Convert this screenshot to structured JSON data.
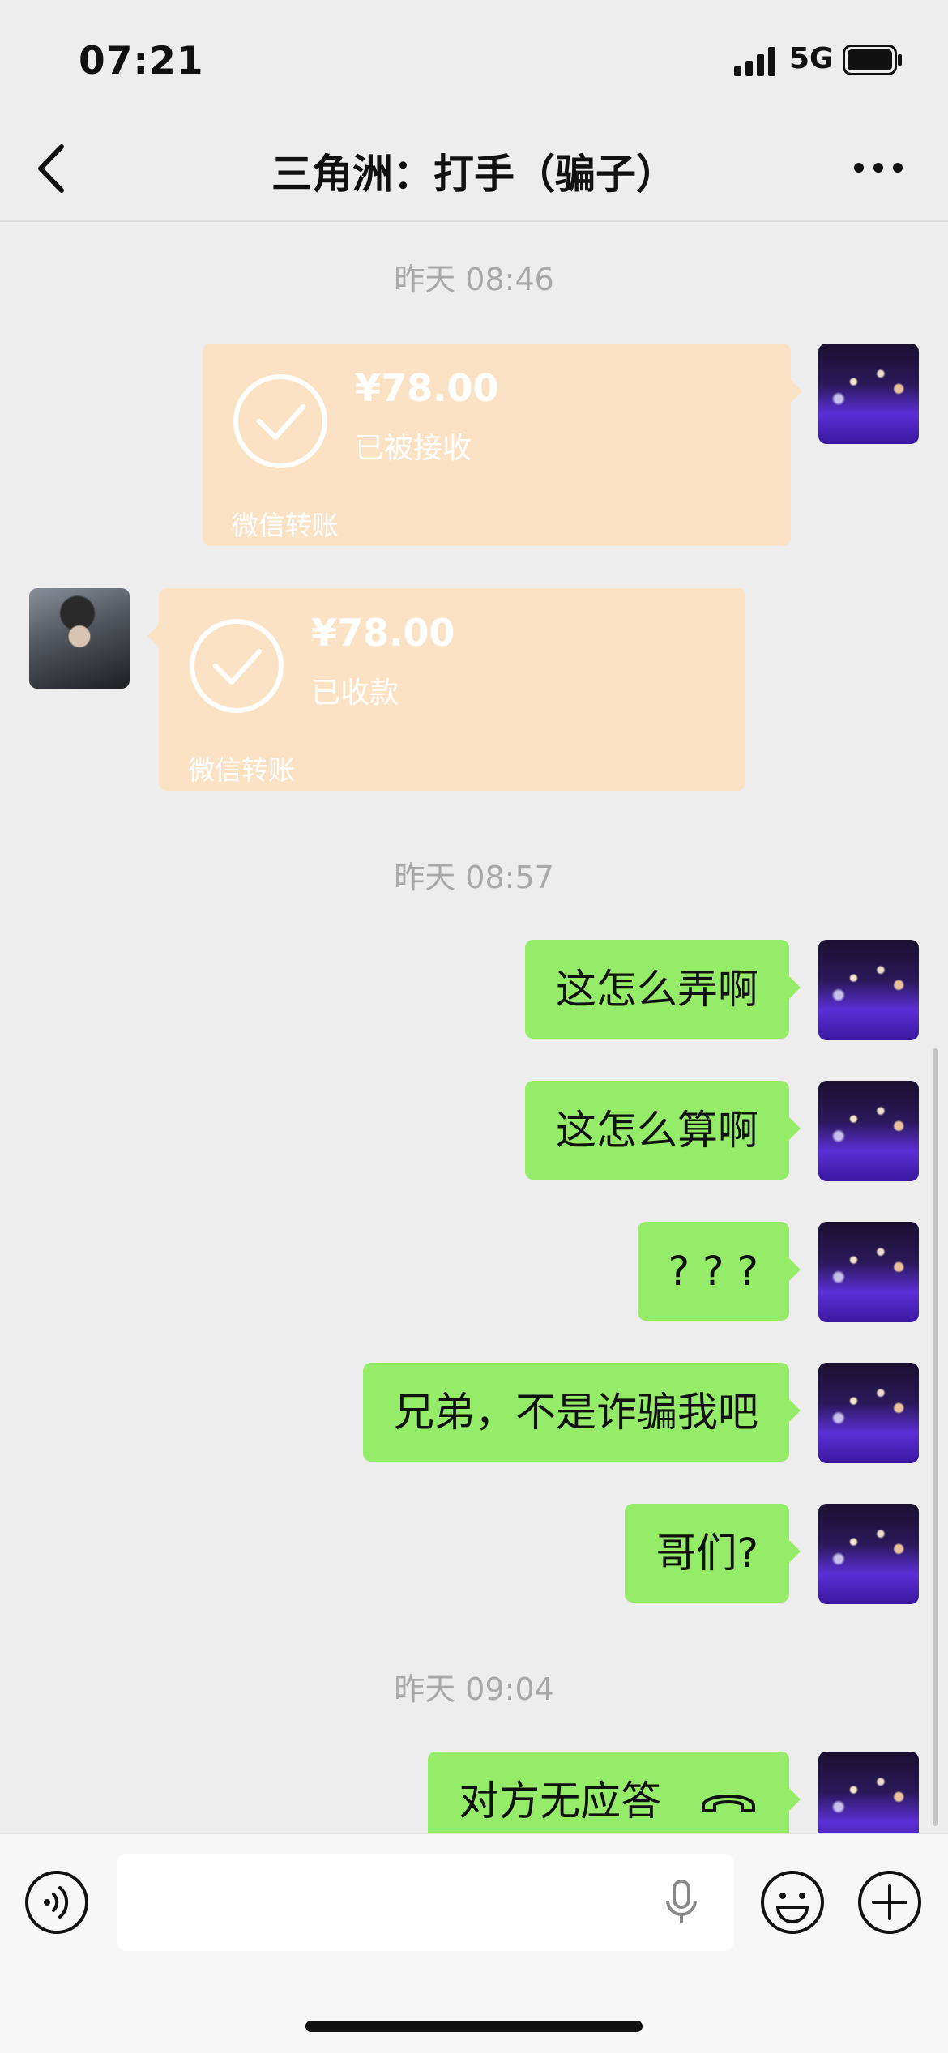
{
  "status_bar": {
    "time": "07:21",
    "network": "5G",
    "signal_icon": "cellular-signal-icon",
    "battery_icon": "battery-icon"
  },
  "header": {
    "title": "三角洲：打手（骗子）",
    "back_icon": "chevron-left-icon",
    "more_icon": "more-dots-icon"
  },
  "chat": {
    "timestamps": [
      "昨天 08:46",
      "昨天 08:57",
      "昨天 09:04"
    ],
    "transfers": [
      {
        "sender": "self",
        "amount": "¥78.00",
        "status": "已被接收",
        "footer": "微信转账",
        "icon": "check-circle-icon"
      },
      {
        "sender": "other",
        "amount": "¥78.00",
        "status": "已收款",
        "footer": "微信转账",
        "icon": "check-circle-icon"
      }
    ],
    "messages": [
      {
        "sender": "self",
        "text": "这怎么弄啊"
      },
      {
        "sender": "self",
        "text": "这怎么算啊"
      },
      {
        "sender": "self",
        "text": "? ? ?"
      },
      {
        "sender": "self",
        "text": "兄弟，不是诈骗我吧"
      },
      {
        "sender": "self",
        "text": "哥们?"
      },
      {
        "sender": "self",
        "text": "对方无应答",
        "icon": "phone-hangup-icon"
      }
    ]
  },
  "input_bar": {
    "voice_icon": "voice-mode-icon",
    "mic_icon": "microphone-icon",
    "emoji_icon": "emoji-icon",
    "plus_icon": "plus-circle-icon"
  },
  "colors": {
    "background": "#EDEDED",
    "self_bubble": "#95EC69",
    "transfer_bubble": "#FCE2C4",
    "timestamp_text": "#A8A8A8"
  }
}
